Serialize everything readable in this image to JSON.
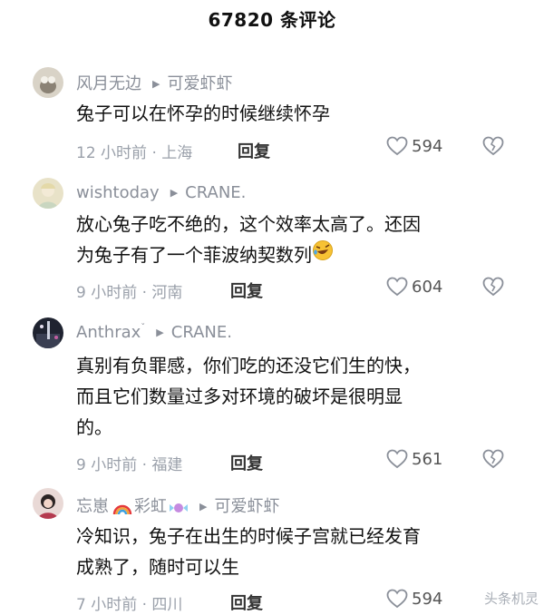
{
  "header": {
    "title": "67820 条评论"
  },
  "comments": [
    {
      "user": "风月无边",
      "reply_to": "可爱虾虾",
      "text": [
        "兔子可以在怀孕的时候继续怀孕"
      ],
      "time": "12 小时前 · 上海",
      "reply_label": "回复",
      "likes": "594"
    },
    {
      "user": "wishtoday",
      "reply_to": "CRANE.",
      "text": [
        "放心兔子吃不绝的，这个效率太高了。还因",
        "为兔子有了一个菲波纳契数列"
      ],
      "emoji": "rofl-emoji",
      "time": "9 小时前 · 河南",
      "reply_label": "回复",
      "likes": "604"
    },
    {
      "user": "Anthrax",
      "reply_to": "CRANE.",
      "text": [
        "真别有负罪感，你们吃的还没它们生的快，",
        "而且它们数量过多对环境的破坏是很明显",
        "的。"
      ],
      "time": "9 小时前 · 福建",
      "reply_label": "回复",
      "likes": "561"
    },
    {
      "user": "忘崽",
      "user_suffix": "彩虹",
      "reply_to": "可爱虾虾",
      "text": [
        "冷知识，兔子在出生的时候子宫就已经发育",
        "成熟了，随时可以生"
      ],
      "time": "7 小时前 · 四川",
      "reply_label": "回复",
      "likes": "594"
    }
  ],
  "watermark": "头条机灵",
  "colors": {
    "meta": "#9aa0aa",
    "text": "#111111",
    "icon": "#8a8f99"
  }
}
